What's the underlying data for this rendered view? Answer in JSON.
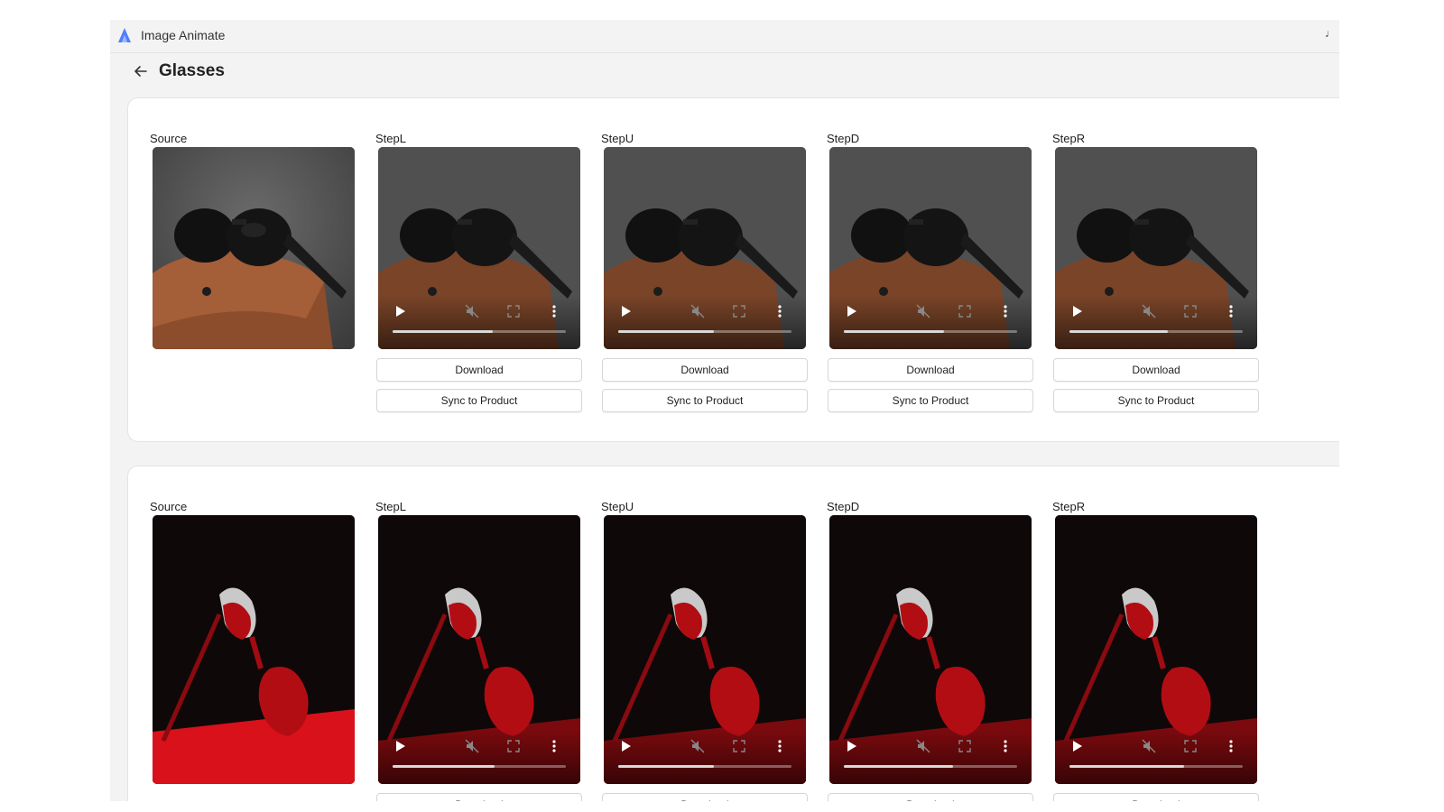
{
  "app": {
    "title": "Image Animate",
    "logo_icon": "app-logo-icon",
    "corner_icon": "music-note-icon"
  },
  "page": {
    "title": "Glasses",
    "back_icon": "arrow-left-icon"
  },
  "buttons": {
    "download": "Download",
    "sync": "Sync to Product"
  },
  "colors": {
    "accent": "#4f7cff",
    "window_bg": "#f3f3f3",
    "card_bg": "#ffffff",
    "border": "#d6d6d6"
  },
  "groups": [
    {
      "image_theme": "black-sunglasses-on-brown-case",
      "source_label": "Source",
      "steps": [
        {
          "label": "StepL",
          "progress": 0.58
        },
        {
          "label": "StepU",
          "progress": 0.55
        },
        {
          "label": "StepD",
          "progress": 0.58
        },
        {
          "label": "StepR",
          "progress": 0.57
        }
      ]
    },
    {
      "image_theme": "red-sunglasses-on-red-surface",
      "source_label": "Source",
      "steps": [
        {
          "label": "StepL",
          "progress": 0.59
        },
        {
          "label": "StepU",
          "progress": 0.55
        },
        {
          "label": "StepD",
          "progress": 0.63
        },
        {
          "label": "StepR",
          "progress": 0.66
        }
      ]
    }
  ]
}
